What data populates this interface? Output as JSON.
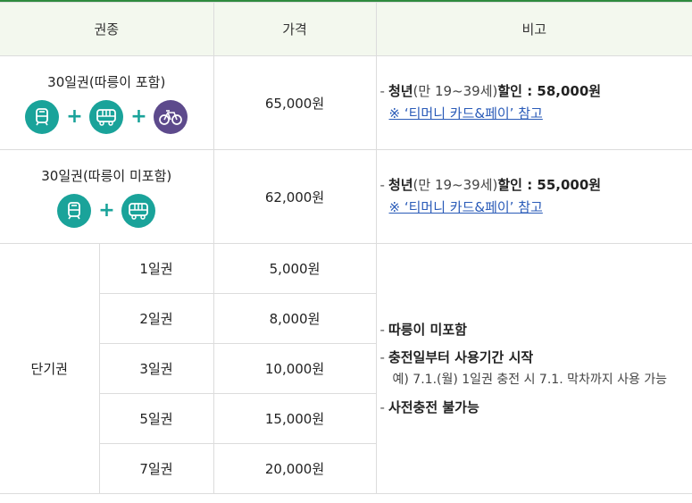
{
  "header": {
    "col_type": "권종",
    "col_price": "가격",
    "col_note": "비고"
  },
  "pass_with_bike": {
    "title": "30일권(따릉이 포함)",
    "price": "65,000원",
    "note_lead": "청년",
    "note_mid": "(만 19~39세)",
    "note_tail": "할인 : 58,000원",
    "note_link": "※ ‘티머니 카드&페이’ 참고",
    "icons": [
      "bus-icon",
      "subway-icon",
      "bicycle-icon"
    ]
  },
  "pass_without_bike": {
    "title": "30일권(따릉이 미포함)",
    "price": "62,000원",
    "note_lead": "청년",
    "note_mid": "(만 19~39세)",
    "note_tail": "할인 : 55,000원",
    "note_link": "※ ‘티머니 카드&페이’ 참고",
    "icons": [
      "bus-icon",
      "subway-icon"
    ]
  },
  "short_term": {
    "label": "단기권",
    "rows": [
      {
        "name": "1일권",
        "price": "5,000원"
      },
      {
        "name": "2일권",
        "price": "8,000원"
      },
      {
        "name": "3일권",
        "price": "10,000원"
      },
      {
        "name": "5일권",
        "price": "15,000원"
      },
      {
        "name": "7일권",
        "price": "20,000원"
      }
    ],
    "notes": {
      "n1": "따릉이 미포함",
      "n2": "충전일부터 사용기간 시작",
      "n2_example": "예) 7.1.(월) 1일권 충전 시 7.1. 막차까지 사용 가능",
      "n3": "사전충전 불가능"
    }
  },
  "symbols": {
    "dash": "-",
    "plus": "+"
  },
  "colors": {
    "accent_green": "#2e8b3e",
    "header_bg": "#f3f8ee",
    "icon_teal": "#1aa39a",
    "icon_purple": "#5d4a8c",
    "link_blue": "#2a5bb8"
  }
}
